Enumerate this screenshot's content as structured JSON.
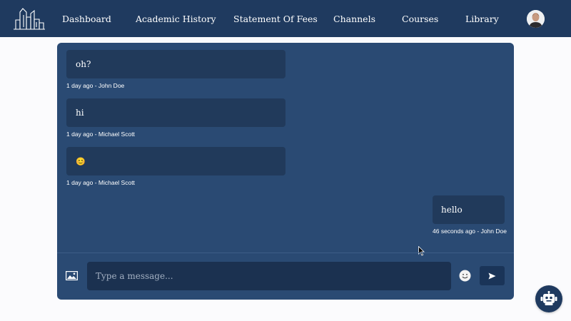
{
  "nav": {
    "items": [
      {
        "label": "Dashboard"
      },
      {
        "label": "Academic History"
      },
      {
        "label": "Statement Of Fees"
      },
      {
        "label": "Channels"
      },
      {
        "label": "Courses"
      },
      {
        "label": "Library"
      }
    ]
  },
  "chat": {
    "messages": [
      {
        "text": "oh?",
        "meta": "1 day ago - John Doe",
        "side": "left"
      },
      {
        "text": "hi",
        "meta": "1 day ago - Michael Scott",
        "side": "left"
      },
      {
        "text": "😊",
        "meta": "1 day ago - Michael Scott",
        "side": "left"
      },
      {
        "text": "hello",
        "meta": "46 seconds ago - John Doe",
        "side": "right"
      }
    ],
    "input": {
      "placeholder": "Type a message...",
      "value": ""
    }
  },
  "colors": {
    "nav_bg": "#1f3a5f",
    "panel_bg": "#2a4a73",
    "bubble_bg": "#213a5b",
    "input_bg": "#1b3150",
    "page_bg": "#fbfbfd"
  },
  "icons": {
    "logo": "city-buildings-logo",
    "image_upload": "image-icon",
    "emoji": "smiley-icon",
    "send": "send-icon",
    "bot": "robot-icon"
  }
}
